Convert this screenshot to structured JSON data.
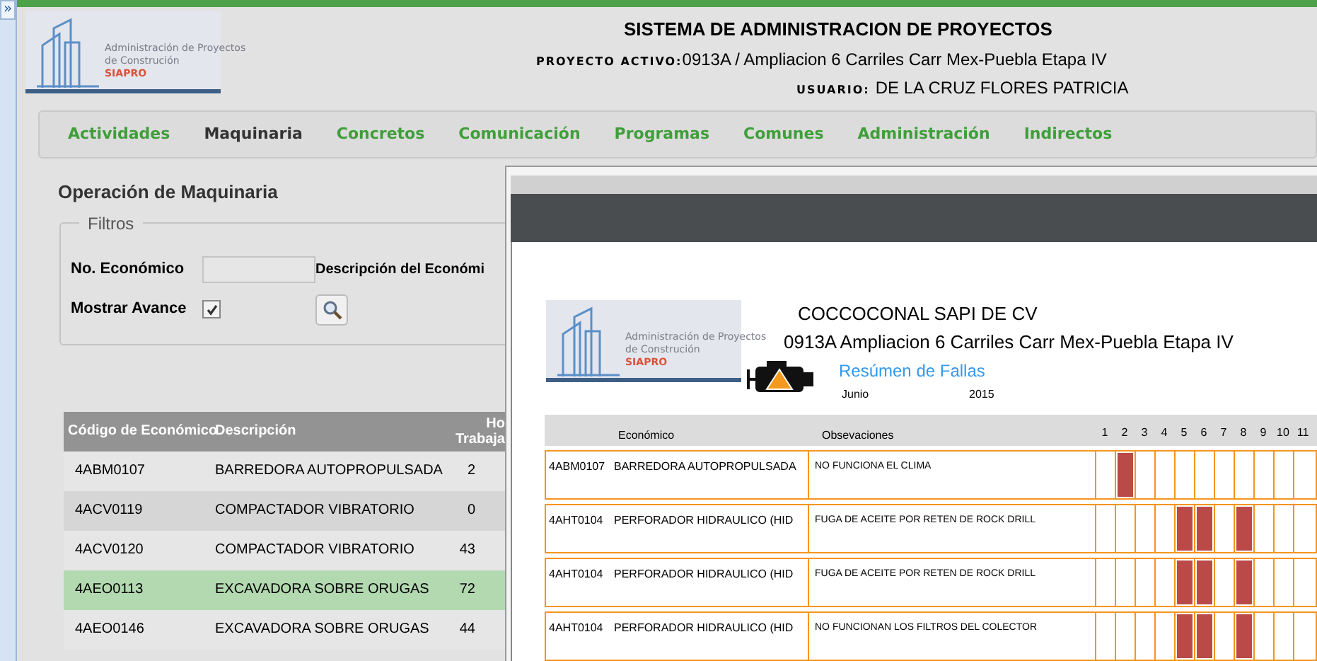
{
  "side_toggle": {
    "label": "»"
  },
  "logo": {
    "lines": [
      "Administración de Proyectos",
      "de Construción"
    ],
    "brand": "SIAPRO"
  },
  "header": {
    "title": "SISTEMA DE ADMINISTRACION DE PROYECTOS",
    "project_label": "PROYECTO ACTIVO:",
    "project": "0913A / Ampliacion 6 Carriles Carr Mex-Puebla Etapa IV",
    "user_label": "USUARIO:",
    "user": "DE LA CRUZ FLORES PATRICIA"
  },
  "nav": [
    {
      "label": "Actividades",
      "selected": false
    },
    {
      "label": "Maquinaria",
      "selected": true
    },
    {
      "label": "Concretos",
      "selected": false
    },
    {
      "label": "Comunicación",
      "selected": false
    },
    {
      "label": "Programas",
      "selected": false
    },
    {
      "label": "Comunes",
      "selected": false
    },
    {
      "label": "Administración",
      "selected": false
    },
    {
      "label": "Indirectos",
      "selected": false
    }
  ],
  "panel": {
    "title": "Operación de Maquinaria",
    "filters": {
      "legend": "Filtros",
      "no_economico_label": "No. Económico",
      "descripcion_label": "Descripción del Económi",
      "mostrar_avance_label": "Mostrar Avance",
      "mostrar_avance_checked": true
    }
  },
  "table": {
    "columns": [
      "Código de Económico",
      "Descripción",
      "Ho\nTrabaja"
    ],
    "rows": [
      {
        "code": "4ABM0107",
        "description": "BARREDORA AUTOPROPULSADA",
        "column_3": "2",
        "selected": false
      },
      {
        "code": "4ACV0119",
        "description": "COMPACTADOR VIBRATORIO",
        "column_3": "0",
        "selected": false
      },
      {
        "code": "4ACV0120",
        "description": "COMPACTADOR VIBRATORIO",
        "column_3": "43",
        "selected": false
      },
      {
        "code": "4AEO0113",
        "description": "EXCAVADORA SOBRE ORUGAS",
        "column_3": "72",
        "selected": true
      },
      {
        "code": "4AEO0146",
        "description": "EXCAVADORA SOBRE ORUGAS",
        "column_3": "44",
        "selected": false
      }
    ]
  },
  "report": {
    "logo": {
      "lines": [
        "Administración de Proyectos",
        "de Construción"
      ],
      "brand": "SIAPRO"
    },
    "company": "COCCOCONAL SAPI DE CV",
    "project": "0913A Ampliacion 6 Carriles Carr Mex-Puebla Etapa IV",
    "title": "Resúmen de Fallas",
    "month": "Junio",
    "year": "2015",
    "columns": [
      "Económico",
      "Obsevaciones"
    ],
    "days": [
      "1",
      "2",
      "3",
      "4",
      "5",
      "6",
      "7",
      "8",
      "9",
      "10",
      "11"
    ],
    "rows": [
      {
        "code": "4ABM0107",
        "name": "BARREDORA AUTOPROPULSADA",
        "observation": "NO FUNCIONA EL CLIMA",
        "failed": [
          false,
          true,
          false,
          false,
          false,
          false,
          false,
          false,
          false,
          false,
          false
        ]
      },
      {
        "code": "4AHT0104",
        "name": "PERFORADOR HIDRAULICO (HID",
        "observation": "FUGA DE ACEITE POR RETEN DE ROCK DRILL",
        "failed": [
          false,
          false,
          false,
          false,
          true,
          true,
          false,
          true,
          false,
          false,
          false
        ]
      },
      {
        "code": "4AHT0104",
        "name": "PERFORADOR HIDRAULICO (HID",
        "observation": "FUGA DE ACEITE POR RETEN DE ROCK DRILL",
        "failed": [
          false,
          false,
          false,
          false,
          true,
          true,
          false,
          true,
          false,
          false,
          false
        ]
      },
      {
        "code": "4AHT0104",
        "name": "PERFORADOR HIDRAULICO (HID",
        "observation": "NO FUNCIONAN LOS FILTROS DEL COLECTOR",
        "failed": [
          false,
          false,
          false,
          false,
          true,
          true,
          false,
          true,
          false,
          false,
          false
        ]
      }
    ]
  }
}
